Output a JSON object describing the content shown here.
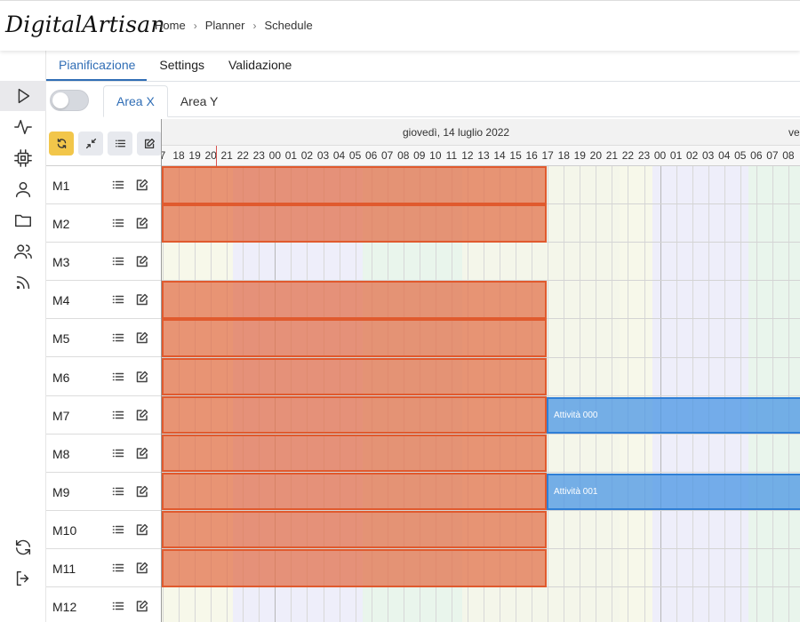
{
  "app": {
    "logo": "DigitalArtisan"
  },
  "breadcrumb": {
    "items": [
      "Home",
      "Planner",
      "Schedule"
    ],
    "separator": "›"
  },
  "sidebar": {
    "icons": [
      "play-icon",
      "activity-icon",
      "chip-icon",
      "user-icon",
      "folder-icon",
      "users-icon",
      "rss-icon",
      "refresh-icon",
      "logout-icon"
    ]
  },
  "tabs": {
    "items": [
      "Pianificazione",
      "Settings",
      "Validazione"
    ],
    "active": "Pianificazione"
  },
  "subtabs": {
    "items": [
      "Area X",
      "Area Y"
    ],
    "active": "Area X"
  },
  "toggle": {
    "on": false
  },
  "toolbar": {
    "buttons": [
      "refresh-icon",
      "collapse-icon",
      "list-icon",
      "edit-icon"
    ]
  },
  "timeline": {
    "date": "giovedì, 14 luglio 2022",
    "next_date_partial": "ve",
    "hours": [
      "7",
      "18",
      "19",
      "20",
      "21",
      "22",
      "23",
      "00",
      "01",
      "02",
      "03",
      "04",
      "05",
      "06",
      "07",
      "08",
      "09",
      "10",
      "11",
      "12",
      "13",
      "14",
      "15",
      "16",
      "17",
      "18",
      "19",
      "20",
      "21",
      "22",
      "23",
      "00",
      "01",
      "02",
      "03",
      "04",
      "05",
      "06",
      "07",
      "08",
      "0"
    ]
  },
  "rows": [
    {
      "name": "M1",
      "busy": true,
      "activity": ""
    },
    {
      "name": "M2",
      "busy": true,
      "activity": ""
    },
    {
      "name": "M3",
      "busy": false,
      "activity": ""
    },
    {
      "name": "M4",
      "busy": true,
      "activity": ""
    },
    {
      "name": "M5",
      "busy": true,
      "activity": ""
    },
    {
      "name": "M6",
      "busy": true,
      "activity": ""
    },
    {
      "name": "M7",
      "busy": true,
      "activity": "Attività 000"
    },
    {
      "name": "M8",
      "busy": true,
      "activity": ""
    },
    {
      "name": "M9",
      "busy": true,
      "activity": "Attività 001"
    },
    {
      "name": "M10",
      "busy": true,
      "activity": ""
    },
    {
      "name": "M11",
      "busy": true,
      "activity": ""
    },
    {
      "name": "M12",
      "busy": false,
      "activity": ""
    }
  ],
  "colors": {
    "accent": "#2f6db5",
    "busy": "#e05a2e",
    "activity": "#4a96e4",
    "toolbar_primary": "#f2c64a"
  }
}
